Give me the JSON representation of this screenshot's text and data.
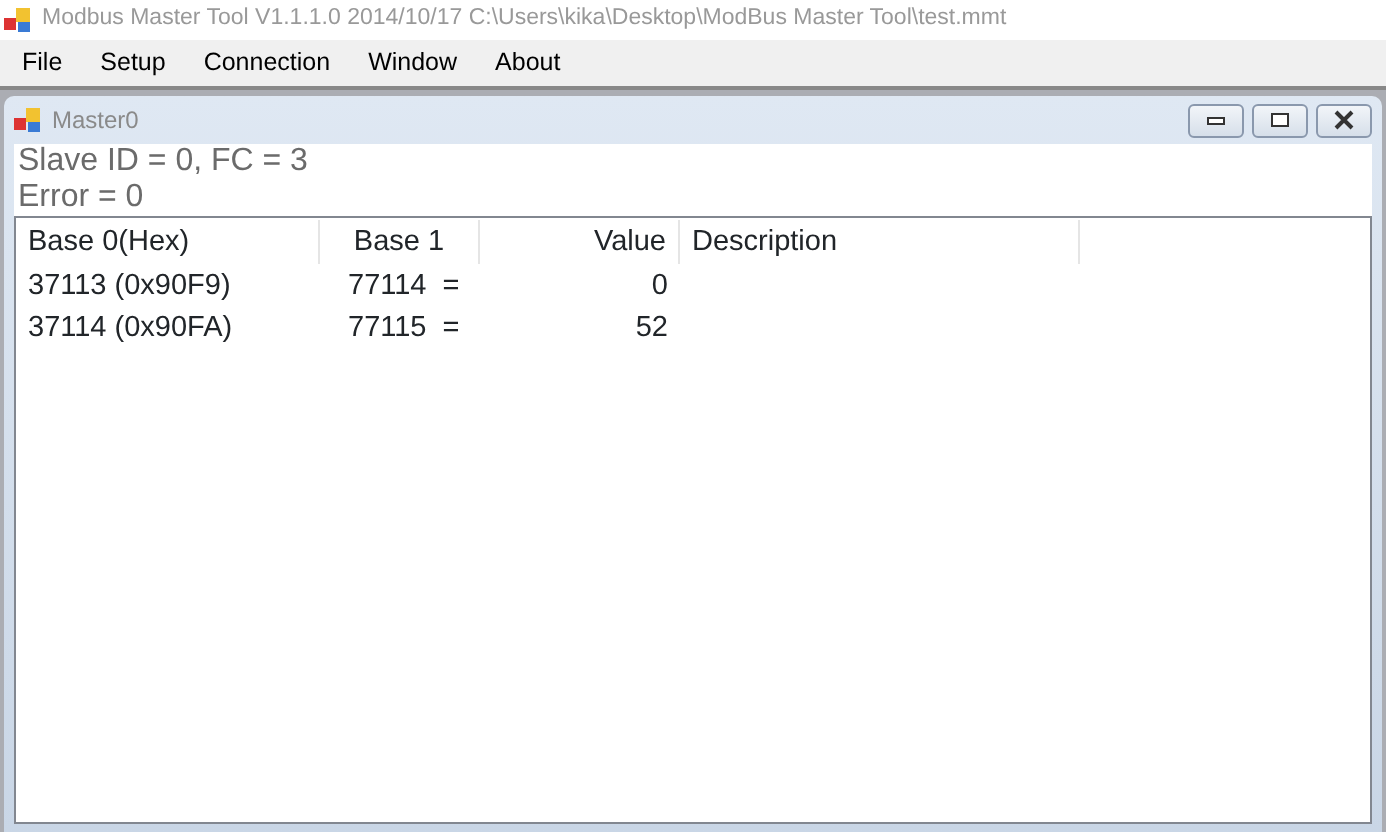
{
  "window": {
    "title": "Modbus Master Tool V1.1.1.0  2014/10/17  C:\\Users\\kika\\Desktop\\ModBus Master Tool\\test.mmt"
  },
  "menu": [
    "File",
    "Setup",
    "Connection",
    "Window",
    "About"
  ],
  "child_window": {
    "title": "Master0",
    "status_lines": [
      "Slave ID = 0, FC = 3",
      "Error = 0"
    ]
  },
  "table": {
    "columns": [
      "Base 0(Hex)",
      "Base 1",
      "Value",
      "Description"
    ],
    "rows": [
      [
        "37113 (0x90F9)",
        "77114  =",
        "0"
      ],
      [
        "37114 (0x90FA)",
        "77115  =",
        "52"
      ]
    ]
  }
}
